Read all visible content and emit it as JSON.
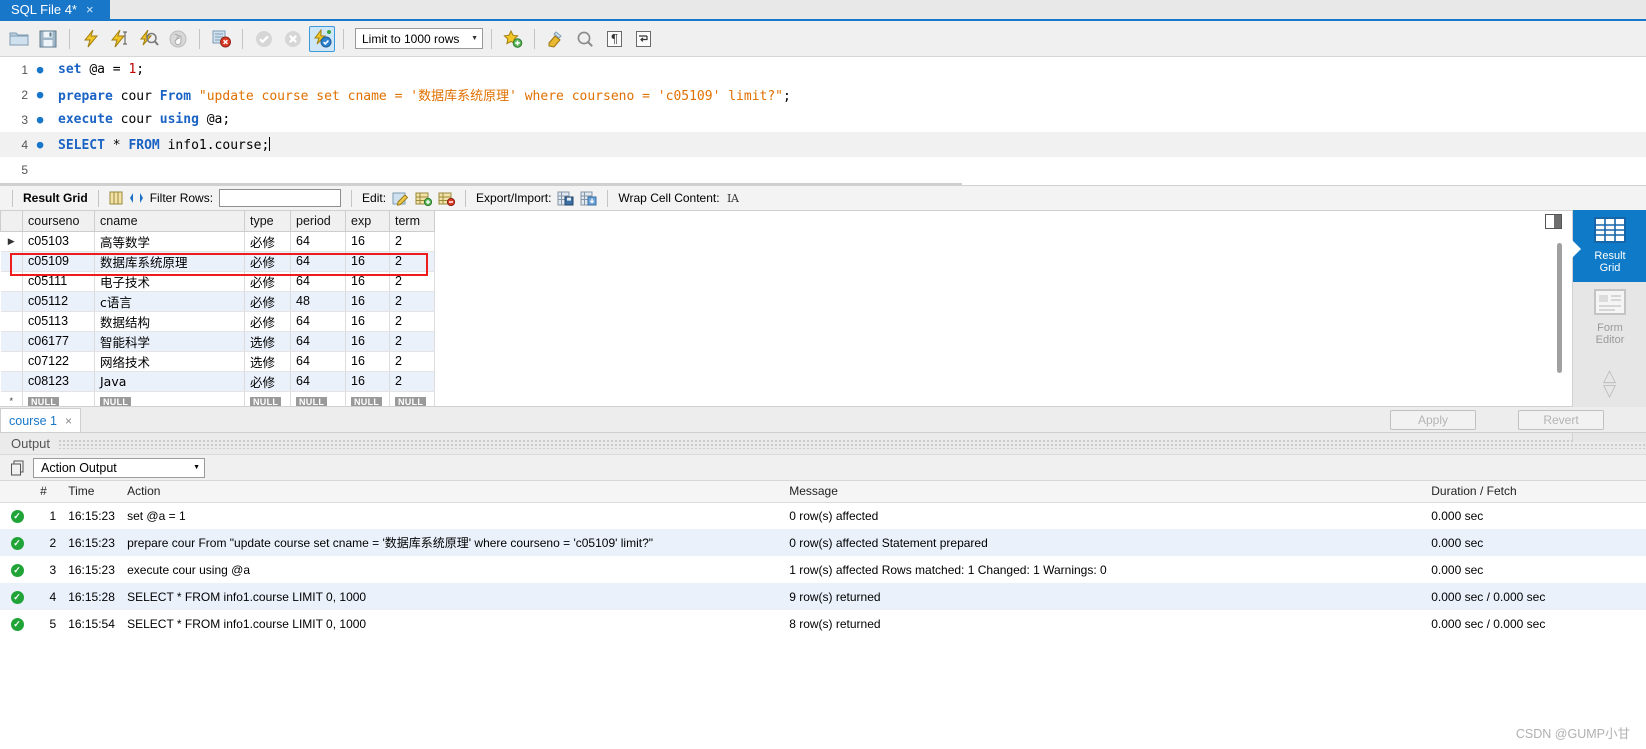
{
  "window": {
    "file_tab": {
      "title": "SQL File 4*",
      "close": "×"
    }
  },
  "toolbar": {
    "icons": [
      {
        "name": "open-file-icon",
        "glyph": "folder"
      },
      {
        "name": "save-file-icon",
        "glyph": "save"
      },
      {
        "name": "execute-icon",
        "glyph": "bolt"
      },
      {
        "name": "execute-current-statement-icon",
        "glyph": "bolt-cursor"
      },
      {
        "name": "explain-icon",
        "glyph": "bolt-magnifier"
      },
      {
        "name": "stop-icon",
        "glyph": "hand"
      },
      {
        "name": "toggle-stop-on-error-icon",
        "glyph": "stop-error"
      },
      {
        "name": "commit-icon",
        "glyph": "check"
      },
      {
        "name": "rollback-icon",
        "glyph": "cross"
      },
      {
        "name": "toggle-autocommit-icon",
        "glyph": "bolt-check"
      }
    ],
    "limit_label": "Limit to 1000 rows",
    "right_icons": [
      {
        "name": "save-snippet-icon",
        "glyph": "star-plus"
      },
      {
        "name": "beautify-query-icon",
        "glyph": "brush"
      },
      {
        "name": "find-icon",
        "glyph": "magnifier"
      },
      {
        "name": "toggle-invisible-chars-icon",
        "glyph": "pilcrow"
      },
      {
        "name": "toggle-wrapping-icon",
        "glyph": "wrap"
      }
    ]
  },
  "editor": {
    "lines": [
      {
        "n": "1",
        "marker": true,
        "current": false,
        "tokens": [
          {
            "t": "set ",
            "c": "kw"
          },
          {
            "t": "@a = ",
            "c": ""
          },
          {
            "t": "1",
            "c": "num"
          },
          {
            "t": ";",
            "c": ""
          }
        ]
      },
      {
        "n": "2",
        "marker": true,
        "current": false,
        "tokens": [
          {
            "t": "prepare ",
            "c": "kw"
          },
          {
            "t": "cour ",
            "c": ""
          },
          {
            "t": "From ",
            "c": "kw"
          },
          {
            "t": "\"update course set cname = ",
            "c": "str"
          },
          {
            "t": "'数据库系统原理'",
            "c": "str"
          },
          {
            "t": " where courseno = 'c05109' limit?\"",
            "c": "str"
          },
          {
            "t": ";",
            "c": ""
          }
        ]
      },
      {
        "n": "3",
        "marker": true,
        "current": false,
        "tokens": [
          {
            "t": "execute ",
            "c": "kw"
          },
          {
            "t": "cour ",
            "c": ""
          },
          {
            "t": "using ",
            "c": "kw"
          },
          {
            "t": "@a;",
            "c": ""
          }
        ]
      },
      {
        "n": "4",
        "marker": true,
        "current": true,
        "tokens": [
          {
            "t": "SELECT ",
            "c": "kw"
          },
          {
            "t": "* ",
            "c": ""
          },
          {
            "t": "FROM ",
            "c": "kw"
          },
          {
            "t": "info1.course;",
            "c": ""
          }
        ]
      },
      {
        "n": "5",
        "marker": false,
        "current": false,
        "tokens": []
      }
    ]
  },
  "result_toolbar": {
    "title": "Result Grid",
    "grid_icon": "grid-view-icon",
    "refresh_icon": "refresh-icon",
    "filter_label": "Filter Rows:",
    "filter_value": "",
    "filter_placeholder": "",
    "edit_label": "Edit:",
    "edit_icons": [
      "edit-cell-icon",
      "insert-row-icon",
      "delete-row-icon"
    ],
    "export_label": "Export/Import:",
    "export_icons": [
      "export-recordset-icon",
      "import-recordset-icon"
    ],
    "wrap_label": "Wrap Cell Content:",
    "wrap_icon": "wrap-cell-icon"
  },
  "result_grid": {
    "columns": [
      "",
      "courseno",
      "cname",
      "type",
      "period",
      "exp",
      "term"
    ],
    "rows": [
      {
        "marker": "▶",
        "cells": [
          "c05103",
          "高等数学",
          "必修",
          "64",
          "16",
          "2"
        ],
        "highlighted": false
      },
      {
        "marker": "",
        "cells": [
          "c05109",
          "数据库系统原理",
          "必修",
          "64",
          "16",
          "2"
        ],
        "highlighted": true
      },
      {
        "marker": "",
        "cells": [
          "c05111",
          "电子技术",
          "必修",
          "64",
          "16",
          "2"
        ],
        "highlighted": false
      },
      {
        "marker": "",
        "cells": [
          "c05112",
          "c语言",
          "必修",
          "48",
          "16",
          "2"
        ],
        "highlighted": false
      },
      {
        "marker": "",
        "cells": [
          "c05113",
          "数据结构",
          "必修",
          "64",
          "16",
          "2"
        ],
        "highlighted": false
      },
      {
        "marker": "",
        "cells": [
          "c06177",
          "智能科学",
          "选修",
          "64",
          "16",
          "2"
        ],
        "highlighted": false
      },
      {
        "marker": "",
        "cells": [
          "c07122",
          "网络技术",
          "选修",
          "64",
          "16",
          "2"
        ],
        "highlighted": false
      },
      {
        "marker": "",
        "cells": [
          "c08123",
          "Java",
          "必修",
          "64",
          "16",
          "2"
        ],
        "highlighted": false
      }
    ],
    "null_row": {
      "marker": "*",
      "label": "NULL",
      "count": 6
    }
  },
  "side_panel": {
    "items": [
      {
        "name": "result-grid",
        "label_line1": "Result",
        "label_line2": "Grid",
        "active": true
      },
      {
        "name": "form-editor",
        "label_line1": "Form",
        "label_line2": "Editor",
        "active": false
      }
    ],
    "nav_up": "⌃",
    "nav_down": "⌄"
  },
  "result_tabs": {
    "tabs": [
      {
        "label": "course 1",
        "close": "×"
      }
    ],
    "apply_label": "Apply",
    "revert_label": "Revert"
  },
  "output": {
    "section_title": "Output",
    "selector_value": "Action Output",
    "columns": [
      "",
      "#",
      "Time",
      "Action",
      "Message",
      "Duration / Fetch"
    ],
    "rows": [
      {
        "status": "success",
        "num": "1",
        "time": "16:15:23",
        "action": "set @a = 1",
        "message": "0 row(s) affected",
        "duration": "0.000 sec"
      },
      {
        "status": "success",
        "num": "2",
        "time": "16:15:23",
        "action": "prepare cour From \"update course set cname = '数据库系统原理' where courseno = 'c05109' limit?\"",
        "message": "0 row(s) affected Statement prepared",
        "duration": "0.000 sec"
      },
      {
        "status": "success",
        "num": "3",
        "time": "16:15:23",
        "action": "execute cour using @a",
        "message": "1 row(s) affected Rows matched: 1  Changed: 1  Warnings: 0",
        "duration": "0.000 sec"
      },
      {
        "status": "success",
        "num": "4",
        "time": "16:15:28",
        "action": "SELECT * FROM info1.course LIMIT 0, 1000",
        "message": "9 row(s) returned",
        "duration": "0.000 sec / 0.000 sec"
      },
      {
        "status": "success",
        "num": "5",
        "time": "16:15:54",
        "action": "SELECT * FROM info1.course LIMIT 0, 1000",
        "message": "8 row(s) returned",
        "duration": "0.000 sec / 0.000 sec"
      }
    ]
  },
  "watermark": {
    "text": "CSDN @GUMP小甘"
  },
  "colors": {
    "accent": "#1877c9",
    "highlight_box": "#ee1c1c",
    "success": "#20a337",
    "alt_row": "#eaf1fb"
  }
}
